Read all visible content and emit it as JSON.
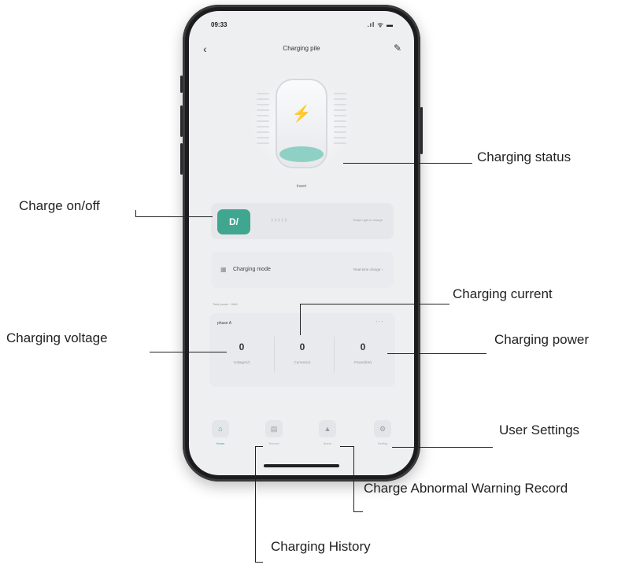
{
  "status_bar": {
    "time": "09:33",
    "icons": ".ıl ᯤ ▬"
  },
  "nav": {
    "back_icon": "‹",
    "title": "Charging pile",
    "edit_icon": "✎"
  },
  "device": {
    "bolt_icon": "⚡",
    "status": "Insert"
  },
  "charge_switch": {
    "button_label": "D/",
    "arrows": "›››››",
    "hint": "Swipe right to charge"
  },
  "charging_mode": {
    "icon": "▦",
    "label": "Charging mode",
    "value": "Real-time charge ›"
  },
  "total_power": "Total power : 0kW",
  "metrics": {
    "phase": "phase A",
    "more_icon": "···",
    "items": [
      {
        "value": "0",
        "unit": "Voltage(V)"
      },
      {
        "value": "0",
        "unit": "Current(A)"
      },
      {
        "value": "0",
        "unit": "Power(kW)"
      }
    ]
  },
  "tabs": [
    {
      "icon": "⌂",
      "label": "Home"
    },
    {
      "icon": "▤",
      "label": "Record"
    },
    {
      "icon": "▲",
      "label": "Alarm"
    },
    {
      "icon": "⚙",
      "label": "Setting"
    }
  ],
  "annotations": {
    "charging_status": "Charging status",
    "charge_onoff": "Charge on/off",
    "charging_current": "Charging current",
    "charging_voltage": "Charging voltage",
    "charging_power": "Charging power",
    "user_settings": "User Settings",
    "abnormal_warning": "Charge Abnormal Warning Record",
    "charging_history": "Charging History"
  },
  "colors": {
    "accent": "#3fa68f",
    "liquid": "#8fd0c4",
    "frame": "#1c1c1e",
    "screen_bg": "#eeeff1"
  }
}
